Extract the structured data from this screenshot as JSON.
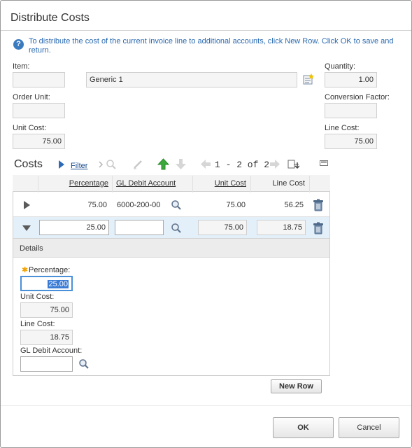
{
  "dialog": {
    "title": "Distribute Costs",
    "info_text": "To distribute the cost of the current invoice line to additional accounts, click New Row. Click OK to save and return."
  },
  "form": {
    "item_label": "Item:",
    "item_value": "",
    "item_description": "Generic 1",
    "quantity_label": "Quantity:",
    "quantity_value": "1.00",
    "order_unit_label": "Order Unit:",
    "order_unit_value": "",
    "conversion_factor_label": "Conversion Factor:",
    "conversion_factor_value": "",
    "unit_cost_label": "Unit Cost:",
    "unit_cost_value": "75.00",
    "line_cost_label": "Line Cost:",
    "line_cost_value": "75.00"
  },
  "costs": {
    "title": "Costs",
    "filter_label": "Filter",
    "pager_text": "1 - 2 of 2",
    "columns": [
      "Percentage",
      "GL Debit Account",
      "Unit Cost",
      "Line Cost"
    ],
    "rows": [
      {
        "percentage": "75.00",
        "gl_account": "6000-200-00",
        "unit_cost": "75.00",
        "line_cost": "56.25"
      },
      {
        "percentage": "25.00",
        "gl_account": "",
        "unit_cost": "75.00",
        "line_cost": "18.75"
      }
    ]
  },
  "details": {
    "title": "Details",
    "percentage_label": "Percentage:",
    "percentage_value": "25.00",
    "unit_cost_label": "Unit Cost:",
    "unit_cost_value": "75.00",
    "line_cost_label": "Line Cost:",
    "line_cost_value": "18.75",
    "gl_account_label": "GL Debit Account:",
    "gl_account_value": ""
  },
  "buttons": {
    "new_row": "New Row",
    "ok": "OK",
    "cancel": "Cancel"
  },
  "colors": {
    "link_blue": "#1a4b8c",
    "info_blue": "#2a6ab0",
    "selected_row": "#e3f0fa",
    "required_star": "#f0a000",
    "arrow_green": "#3aa83a"
  }
}
